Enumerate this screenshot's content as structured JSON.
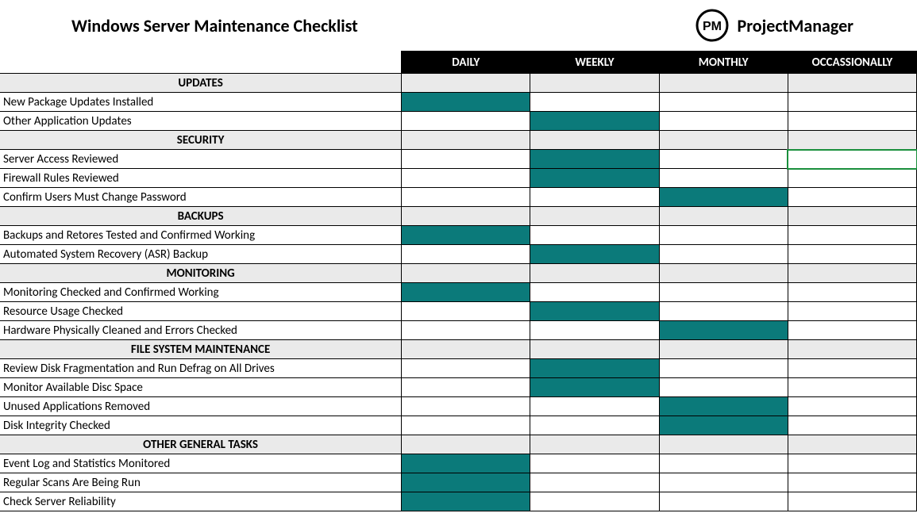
{
  "title": "Windows Server Maintenance Checklist",
  "brand": {
    "name": "ProjectManager",
    "icon_label": "PM"
  },
  "columns": [
    "DAILY",
    "WEEKLY",
    "MONTHLY",
    "OCCASSIONALLY"
  ],
  "colors": {
    "filled": "#0b7a7a",
    "section_bg": "#eaeaea",
    "header_bg": "#000000"
  },
  "selected": {
    "section": 1,
    "row": 0,
    "col": 3
  },
  "sections": [
    {
      "name": "UPDATES",
      "rows": [
        {
          "label": "New Package Updates Installed",
          "freq": [
            true,
            false,
            false,
            false
          ]
        },
        {
          "label": "Other Application Updates",
          "freq": [
            false,
            true,
            false,
            false
          ]
        }
      ]
    },
    {
      "name": "SECURITY",
      "rows": [
        {
          "label": "Server Access Reviewed",
          "freq": [
            false,
            true,
            false,
            false
          ]
        },
        {
          "label": "Firewall Rules Reviewed",
          "freq": [
            false,
            true,
            false,
            false
          ]
        },
        {
          "label": "Confirm Users Must Change Password",
          "freq": [
            false,
            false,
            true,
            false
          ]
        }
      ]
    },
    {
      "name": "BACKUPS",
      "rows": [
        {
          "label": "Backups and Retores Tested and Confirmed Working",
          "freq": [
            true,
            false,
            false,
            false
          ]
        },
        {
          "label": "Automated System Recovery (ASR) Backup",
          "freq": [
            false,
            true,
            false,
            false
          ]
        }
      ]
    },
    {
      "name": "MONITORING",
      "rows": [
        {
          "label": "Monitoring Checked and Confirmed Working",
          "freq": [
            true,
            false,
            false,
            false
          ]
        },
        {
          "label": "Resource Usage Checked",
          "freq": [
            false,
            true,
            false,
            false
          ]
        },
        {
          "label": "Hardware Physically Cleaned and Errors Checked",
          "freq": [
            false,
            false,
            true,
            false
          ]
        }
      ]
    },
    {
      "name": "FILE SYSTEM MAINTENANCE",
      "rows": [
        {
          "label": "Review Disk Fragmentation and Run Defrag on All Drives",
          "freq": [
            false,
            true,
            false,
            false
          ]
        },
        {
          "label": "Monitor Available Disc Space",
          "freq": [
            false,
            true,
            false,
            false
          ]
        },
        {
          "label": "Unused Applications Removed",
          "freq": [
            false,
            false,
            true,
            false
          ]
        },
        {
          "label": "Disk Integrity Checked",
          "freq": [
            false,
            false,
            true,
            false
          ]
        }
      ]
    },
    {
      "name": "OTHER GENERAL TASKS",
      "rows": [
        {
          "label": "Event Log and Statistics Monitored",
          "freq": [
            true,
            false,
            false,
            false
          ]
        },
        {
          "label": "Regular Scans Are Being Run",
          "freq": [
            true,
            false,
            false,
            false
          ]
        },
        {
          "label": "Check Server Reliability",
          "freq": [
            true,
            false,
            false,
            false
          ]
        }
      ]
    }
  ]
}
